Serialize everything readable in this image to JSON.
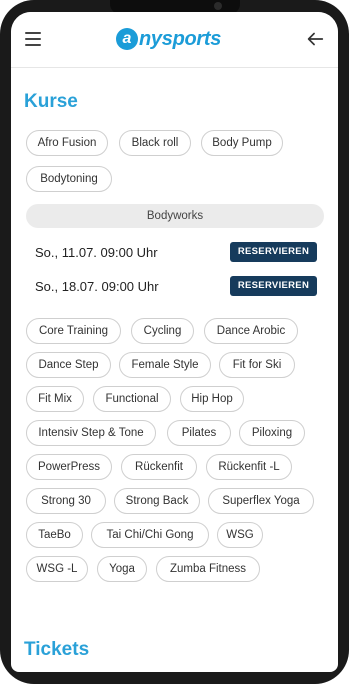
{
  "header": {
    "logo_letter": "a",
    "logo_text": "nysports"
  },
  "courses": {
    "title": "Kurse",
    "chips_top": [
      "Afro Fusion",
      "Black roll",
      "Body Pump",
      "Bodytoning"
    ],
    "expanded": {
      "label": "Bodyworks",
      "sessions": [
        {
          "date": "So., 11.07. 09:00 Uhr",
          "button": "RESERVIEREN"
        },
        {
          "date": "So., 18.07. 09:00 Uhr",
          "button": "RESERVIEREN"
        }
      ]
    },
    "chips_bottom": [
      "Core Training",
      "Cycling",
      "Dance Arobic",
      "Dance Step",
      "Female Style",
      "Fit for Ski",
      "Fit Mix",
      "Functional",
      "Hip Hop",
      "Intensiv Step & Tone",
      "Pilates",
      "Piloxing",
      "PowerPress",
      "Rückenfit",
      "Rückenfit -L",
      "Strong 30",
      "Strong Back",
      "Superflex Yoga",
      "TaeBo",
      "Tai Chi/Chi Gong",
      "WSG",
      "WSG -L",
      "Yoga",
      "Zumba Fitness"
    ]
  },
  "tickets": {
    "title": "Tickets"
  },
  "colors": {
    "accent": "#2aa1d8",
    "button": "#163b5c"
  }
}
